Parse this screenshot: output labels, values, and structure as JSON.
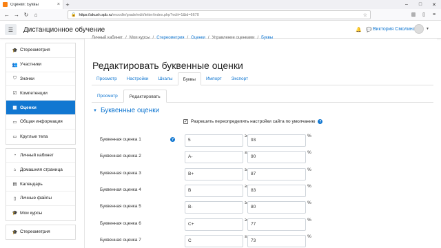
{
  "browser": {
    "tab_title": "Оценки: Буквы",
    "url_host": "https://akush.spb.ru",
    "url_path": "/moodle/grade/edit/letter/index.php?edit=1&id=6670"
  },
  "header": {
    "site_name": "Дистанционное обучение",
    "user_name": "Виктория Смолина"
  },
  "sidebar": {
    "course_items": [
      {
        "label": "Стереометрия",
        "icon": "graduation-cap-icon",
        "glyph": "🎓",
        "active": false
      },
      {
        "label": "Участники",
        "icon": "users-icon",
        "glyph": "👥",
        "active": false
      },
      {
        "label": "Значки",
        "icon": "shield-icon",
        "glyph": "⛉",
        "active": false
      },
      {
        "label": "Компетенции",
        "icon": "checkbox-icon",
        "glyph": "☑",
        "active": false
      },
      {
        "label": "Оценки",
        "icon": "table-icon",
        "glyph": "▦",
        "active": true
      },
      {
        "label": "Общая информация",
        "icon": "folder-icon",
        "glyph": "▭",
        "active": false
      },
      {
        "label": "Круглые тела",
        "icon": "folder-icon",
        "glyph": "▭",
        "active": false
      }
    ],
    "site_items": [
      {
        "label": "Личный кабинет",
        "icon": "dashboard-icon",
        "glyph": "◔"
      },
      {
        "label": "Домашняя страница",
        "icon": "home-icon",
        "glyph": "⌂"
      },
      {
        "label": "Календарь",
        "icon": "calendar-icon",
        "glyph": "▤"
      },
      {
        "label": "Личные файлы",
        "icon": "file-icon",
        "glyph": "▯"
      },
      {
        "label": "Мои курсы",
        "icon": "graduation-cap-icon",
        "glyph": "🎓"
      }
    ],
    "extra_items": [
      {
        "label": "Стереометрия",
        "icon": "graduation-cap-icon",
        "glyph": "🎓"
      }
    ]
  },
  "breadcrumb": {
    "items": [
      "Личный кабинет",
      "Мои курсы",
      "Стереометрия",
      "Оценки",
      "Управление оценками",
      "Буквы"
    ],
    "separator": "/"
  },
  "page": {
    "title": "Редактировать буквенные оценки",
    "tabs": [
      {
        "label": "Просмотр",
        "active": false
      },
      {
        "label": "Настройки",
        "active": false
      },
      {
        "label": "Шкалы",
        "active": false
      },
      {
        "label": "Буквы",
        "active": true
      },
      {
        "label": "Импорт",
        "active": false
      },
      {
        "label": "Экспорт",
        "active": false
      }
    ],
    "subtabs": [
      {
        "label": "Просмотр",
        "active": false
      },
      {
        "label": "Редактировать",
        "active": true
      }
    ],
    "section_title": "Буквенные оценки",
    "override_label": "Разрешить переопределять настройки сайта по умолчанию",
    "override_checked": true,
    "ge_symbol": "≥",
    "pct_symbol": "%",
    "grades": [
      {
        "label": "Буквенная оценка 1",
        "letter": "5",
        "bound": "93"
      },
      {
        "label": "Буквенная оценка 2",
        "letter": "A-",
        "bound": "90"
      },
      {
        "label": "Буквенная оценка 3",
        "letter": "B+",
        "bound": "87"
      },
      {
        "label": "Буквенная оценка 4",
        "letter": "B",
        "bound": "83"
      },
      {
        "label": "Буквенная оценка 5",
        "letter": "B-",
        "bound": "80"
      },
      {
        "label": "Буквенная оценка 6",
        "letter": "C+",
        "bound": "77"
      },
      {
        "label": "Буквенная оценка 7",
        "letter": "C",
        "bound": "73"
      }
    ]
  },
  "colors": {
    "accent": "#1177d1",
    "active_sidebar": "#1177d1"
  }
}
